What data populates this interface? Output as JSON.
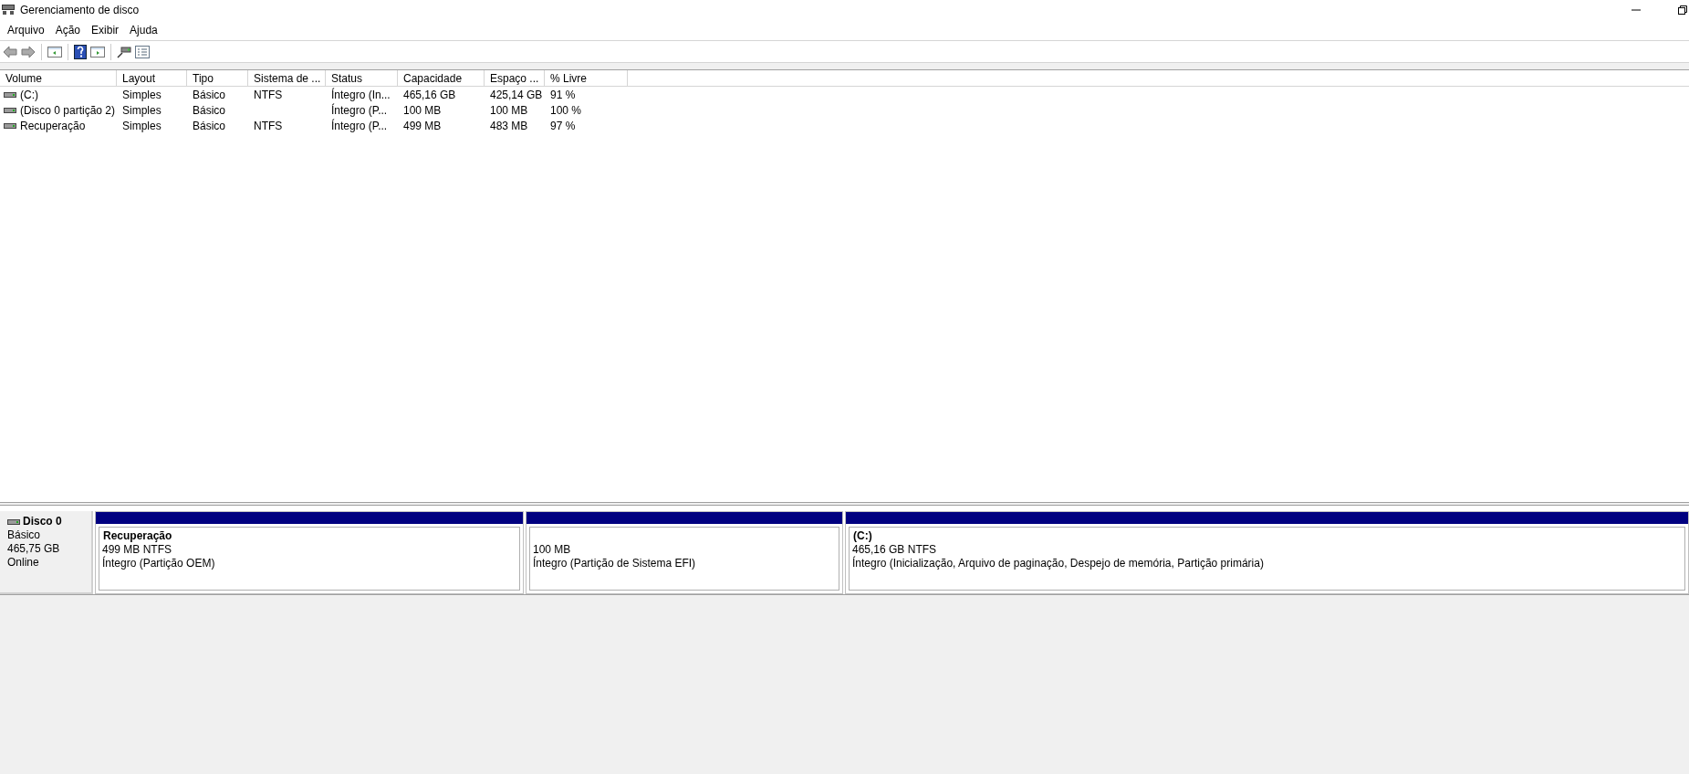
{
  "window": {
    "title": "Gerenciamento de disco"
  },
  "menu": [
    "Arquivo",
    "Ação",
    "Exibir",
    "Ajuda"
  ],
  "table": {
    "columns": [
      "Volume",
      "Layout",
      "Tipo",
      "Sistema de ...",
      "Status",
      "Capacidade",
      "Espaço ...",
      "% Livre"
    ],
    "rows": [
      [
        "(C:)",
        "Simples",
        "Básico",
        "NTFS",
        "Íntegro (In...",
        "465,16 GB",
        "425,14 GB",
        "91 %"
      ],
      [
        "(Disco 0 partição 2)",
        "Simples",
        "Básico",
        "",
        "Íntegro (P...",
        "100 MB",
        "100 MB",
        "100 %"
      ],
      [
        "Recuperação",
        "Simples",
        "Básico",
        "NTFS",
        "Íntegro (P...",
        "499 MB",
        "483 MB",
        "97 %"
      ]
    ]
  },
  "disk": {
    "name": "Disco 0",
    "type": "Básico",
    "size": "465,75 GB",
    "state": "Online",
    "partitions": [
      {
        "title": "Recuperação",
        "size": "499 MB NTFS",
        "status": "Íntegro (Partição OEM)"
      },
      {
        "size": "100 MB",
        "status": "Íntegro (Partição de Sistema EFI)"
      },
      {
        "title": "(C:)",
        "size": "465,16 GB NTFS",
        "status": "Íntegro (Inicialização, Arquivo de paginação, Despejo de memória, Partição primária)"
      }
    ]
  }
}
